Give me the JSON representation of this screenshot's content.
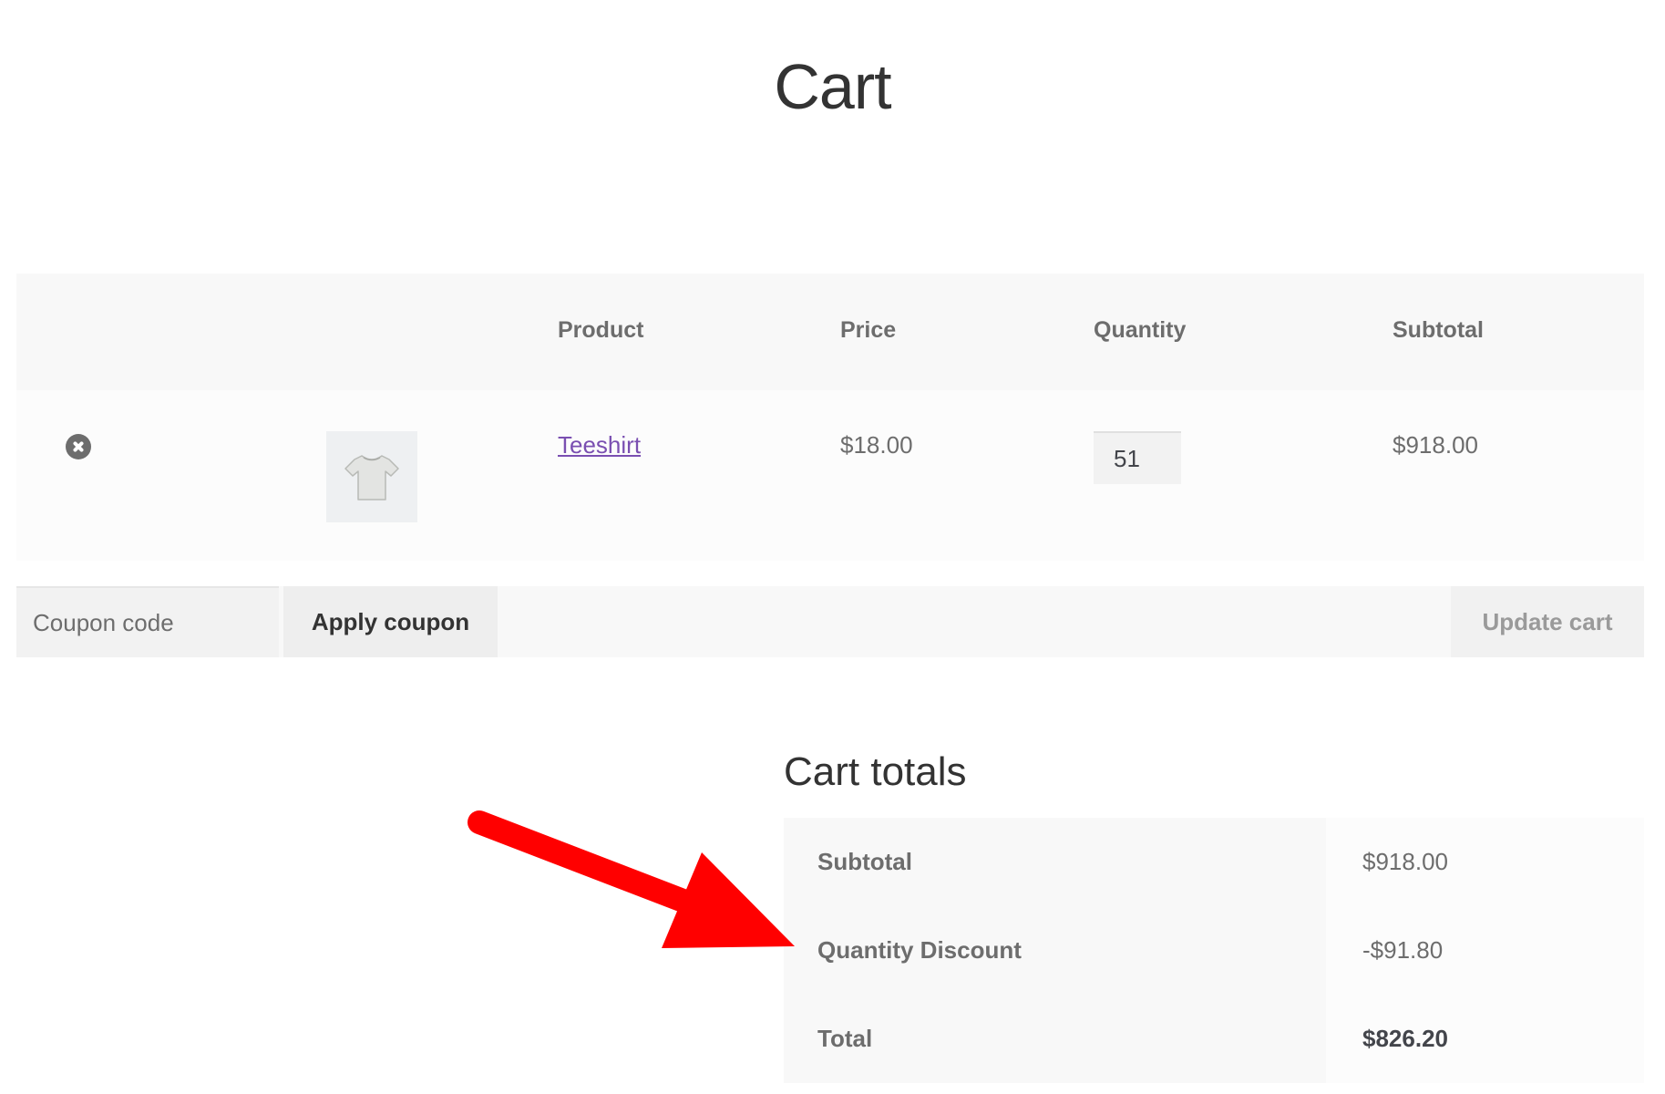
{
  "page": {
    "title": "Cart"
  },
  "cart_table": {
    "headers": {
      "product": "Product",
      "price": "Price",
      "quantity": "Quantity",
      "subtotal": "Subtotal"
    },
    "items": [
      {
        "name": "Teeshirt",
        "price": "$18.00",
        "quantity": "51",
        "subtotal": "$918.00",
        "thumbnail_icon": "tshirt-icon",
        "remove_icon": "remove-circle-icon"
      }
    ]
  },
  "actions": {
    "coupon_placeholder": "Coupon code",
    "apply_label": "Apply coupon",
    "update_label": "Update cart"
  },
  "totals": {
    "title": "Cart totals",
    "rows": [
      {
        "label": "Subtotal",
        "value": "$918.00"
      },
      {
        "label": "Quantity Discount",
        "value": "-$91.80"
      },
      {
        "label": "Total",
        "value": "$826.20"
      }
    ]
  },
  "annotation": {
    "arrow_color": "#ff0000",
    "link_color": "#7a4fb1"
  }
}
